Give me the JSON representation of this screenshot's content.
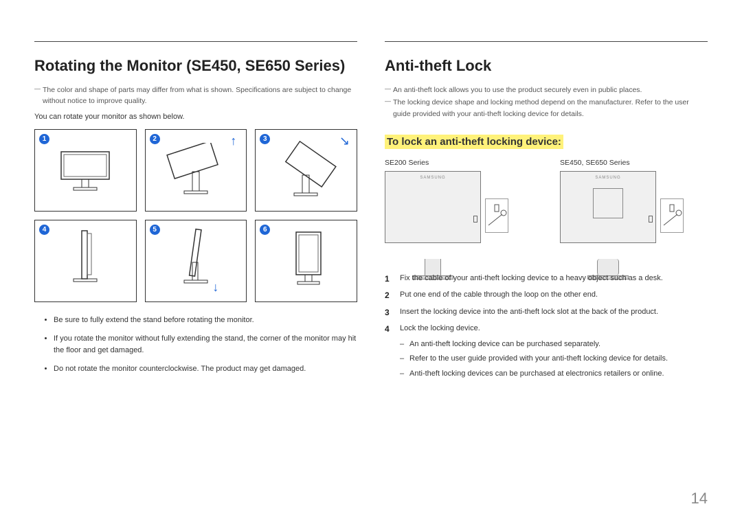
{
  "left": {
    "heading": "Rotating the Monitor (SE450, SE650 Series)",
    "note1": "The color and shape of parts may differ from what is shown. Specifications are subject to change without notice to improve quality.",
    "intro": "You can rotate your monitor as shown below.",
    "badges": [
      "1",
      "2",
      "3",
      "4",
      "5",
      "6"
    ],
    "bullets": [
      "Be sure to fully extend the stand before rotating the monitor.",
      "If you rotate the monitor without fully extending the stand, the corner of the monitor may hit the floor and get damaged.",
      "Do not rotate the monitor counterclockwise. The product may get damaged."
    ]
  },
  "right": {
    "heading": "Anti-theft Lock",
    "note1": "An anti-theft lock allows you to use the product securely even in public places.",
    "note2": "The locking device shape and locking method depend on the manufacturer. Refer to the user guide provided with your anti-theft locking device for details.",
    "subheading": "To lock an anti-theft locking device:",
    "series1": "SE200 Series",
    "series2": "SE450, SE650 Series",
    "steps": [
      "Fix the cable of your anti-theft locking device to a heavy object such as a desk.",
      "Put one end of the cable through the loop on the other end.",
      "Insert the locking device into the anti-theft lock slot at the back of the product.",
      "Lock the locking device."
    ],
    "substeps": [
      "An anti-theft locking device can be purchased separately.",
      "Refer to the user guide provided with your anti-theft locking device for details.",
      "Anti-theft locking devices can be purchased at electronics retailers or online."
    ]
  },
  "page_number": "14"
}
